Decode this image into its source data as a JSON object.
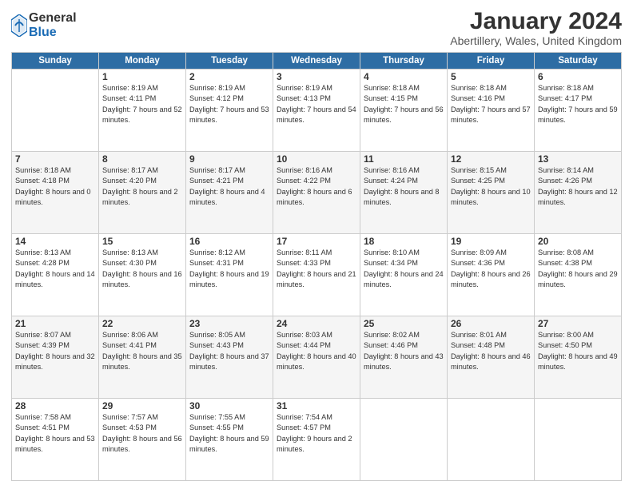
{
  "header": {
    "logo_general": "General",
    "logo_blue": "Blue",
    "month_title": "January 2024",
    "location": "Abertillery, Wales, United Kingdom"
  },
  "weekdays": [
    "Sunday",
    "Monday",
    "Tuesday",
    "Wednesday",
    "Thursday",
    "Friday",
    "Saturday"
  ],
  "weeks": [
    [
      {
        "day": "",
        "sunrise": "",
        "sunset": "",
        "daylight": ""
      },
      {
        "day": "1",
        "sunrise": "Sunrise: 8:19 AM",
        "sunset": "Sunset: 4:11 PM",
        "daylight": "Daylight: 7 hours and 52 minutes."
      },
      {
        "day": "2",
        "sunrise": "Sunrise: 8:19 AM",
        "sunset": "Sunset: 4:12 PM",
        "daylight": "Daylight: 7 hours and 53 minutes."
      },
      {
        "day": "3",
        "sunrise": "Sunrise: 8:19 AM",
        "sunset": "Sunset: 4:13 PM",
        "daylight": "Daylight: 7 hours and 54 minutes."
      },
      {
        "day": "4",
        "sunrise": "Sunrise: 8:18 AM",
        "sunset": "Sunset: 4:15 PM",
        "daylight": "Daylight: 7 hours and 56 minutes."
      },
      {
        "day": "5",
        "sunrise": "Sunrise: 8:18 AM",
        "sunset": "Sunset: 4:16 PM",
        "daylight": "Daylight: 7 hours and 57 minutes."
      },
      {
        "day": "6",
        "sunrise": "Sunrise: 8:18 AM",
        "sunset": "Sunset: 4:17 PM",
        "daylight": "Daylight: 7 hours and 59 minutes."
      }
    ],
    [
      {
        "day": "7",
        "sunrise": "Sunrise: 8:18 AM",
        "sunset": "Sunset: 4:18 PM",
        "daylight": "Daylight: 8 hours and 0 minutes."
      },
      {
        "day": "8",
        "sunrise": "Sunrise: 8:17 AM",
        "sunset": "Sunset: 4:20 PM",
        "daylight": "Daylight: 8 hours and 2 minutes."
      },
      {
        "day": "9",
        "sunrise": "Sunrise: 8:17 AM",
        "sunset": "Sunset: 4:21 PM",
        "daylight": "Daylight: 8 hours and 4 minutes."
      },
      {
        "day": "10",
        "sunrise": "Sunrise: 8:16 AM",
        "sunset": "Sunset: 4:22 PM",
        "daylight": "Daylight: 8 hours and 6 minutes."
      },
      {
        "day": "11",
        "sunrise": "Sunrise: 8:16 AM",
        "sunset": "Sunset: 4:24 PM",
        "daylight": "Daylight: 8 hours and 8 minutes."
      },
      {
        "day": "12",
        "sunrise": "Sunrise: 8:15 AM",
        "sunset": "Sunset: 4:25 PM",
        "daylight": "Daylight: 8 hours and 10 minutes."
      },
      {
        "day": "13",
        "sunrise": "Sunrise: 8:14 AM",
        "sunset": "Sunset: 4:26 PM",
        "daylight": "Daylight: 8 hours and 12 minutes."
      }
    ],
    [
      {
        "day": "14",
        "sunrise": "Sunrise: 8:13 AM",
        "sunset": "Sunset: 4:28 PM",
        "daylight": "Daylight: 8 hours and 14 minutes."
      },
      {
        "day": "15",
        "sunrise": "Sunrise: 8:13 AM",
        "sunset": "Sunset: 4:30 PM",
        "daylight": "Daylight: 8 hours and 16 minutes."
      },
      {
        "day": "16",
        "sunrise": "Sunrise: 8:12 AM",
        "sunset": "Sunset: 4:31 PM",
        "daylight": "Daylight: 8 hours and 19 minutes."
      },
      {
        "day": "17",
        "sunrise": "Sunrise: 8:11 AM",
        "sunset": "Sunset: 4:33 PM",
        "daylight": "Daylight: 8 hours and 21 minutes."
      },
      {
        "day": "18",
        "sunrise": "Sunrise: 8:10 AM",
        "sunset": "Sunset: 4:34 PM",
        "daylight": "Daylight: 8 hours and 24 minutes."
      },
      {
        "day": "19",
        "sunrise": "Sunrise: 8:09 AM",
        "sunset": "Sunset: 4:36 PM",
        "daylight": "Daylight: 8 hours and 26 minutes."
      },
      {
        "day": "20",
        "sunrise": "Sunrise: 8:08 AM",
        "sunset": "Sunset: 4:38 PM",
        "daylight": "Daylight: 8 hours and 29 minutes."
      }
    ],
    [
      {
        "day": "21",
        "sunrise": "Sunrise: 8:07 AM",
        "sunset": "Sunset: 4:39 PM",
        "daylight": "Daylight: 8 hours and 32 minutes."
      },
      {
        "day": "22",
        "sunrise": "Sunrise: 8:06 AM",
        "sunset": "Sunset: 4:41 PM",
        "daylight": "Daylight: 8 hours and 35 minutes."
      },
      {
        "day": "23",
        "sunrise": "Sunrise: 8:05 AM",
        "sunset": "Sunset: 4:43 PM",
        "daylight": "Daylight: 8 hours and 37 minutes."
      },
      {
        "day": "24",
        "sunrise": "Sunrise: 8:03 AM",
        "sunset": "Sunset: 4:44 PM",
        "daylight": "Daylight: 8 hours and 40 minutes."
      },
      {
        "day": "25",
        "sunrise": "Sunrise: 8:02 AM",
        "sunset": "Sunset: 4:46 PM",
        "daylight": "Daylight: 8 hours and 43 minutes."
      },
      {
        "day": "26",
        "sunrise": "Sunrise: 8:01 AM",
        "sunset": "Sunset: 4:48 PM",
        "daylight": "Daylight: 8 hours and 46 minutes."
      },
      {
        "day": "27",
        "sunrise": "Sunrise: 8:00 AM",
        "sunset": "Sunset: 4:50 PM",
        "daylight": "Daylight: 8 hours and 49 minutes."
      }
    ],
    [
      {
        "day": "28",
        "sunrise": "Sunrise: 7:58 AM",
        "sunset": "Sunset: 4:51 PM",
        "daylight": "Daylight: 8 hours and 53 minutes."
      },
      {
        "day": "29",
        "sunrise": "Sunrise: 7:57 AM",
        "sunset": "Sunset: 4:53 PM",
        "daylight": "Daylight: 8 hours and 56 minutes."
      },
      {
        "day": "30",
        "sunrise": "Sunrise: 7:55 AM",
        "sunset": "Sunset: 4:55 PM",
        "daylight": "Daylight: 8 hours and 59 minutes."
      },
      {
        "day": "31",
        "sunrise": "Sunrise: 7:54 AM",
        "sunset": "Sunset: 4:57 PM",
        "daylight": "Daylight: 9 hours and 2 minutes."
      },
      {
        "day": "",
        "sunrise": "",
        "sunset": "",
        "daylight": ""
      },
      {
        "day": "",
        "sunrise": "",
        "sunset": "",
        "daylight": ""
      },
      {
        "day": "",
        "sunrise": "",
        "sunset": "",
        "daylight": ""
      }
    ]
  ]
}
